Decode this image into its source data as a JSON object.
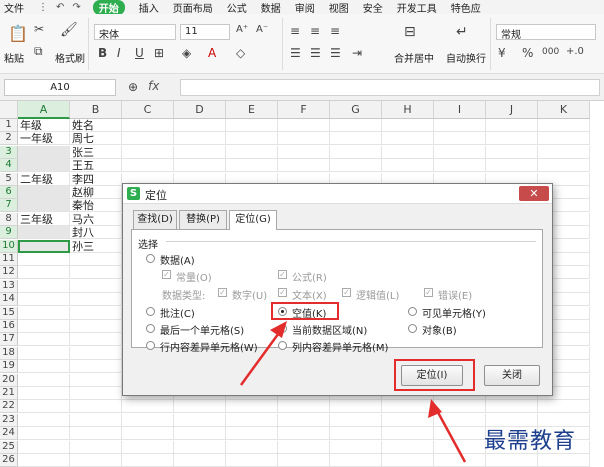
{
  "menubar": {
    "file": "文件",
    "quick": [
      "⋮",
      "↶",
      "↷"
    ],
    "items": [
      "开始",
      "插入",
      "页面布局",
      "公式",
      "数据",
      "审阅",
      "视图",
      "安全",
      "开发工具",
      "特色应"
    ],
    "active_index": 0
  },
  "ribbon": {
    "paste": "粘贴",
    "format_painter": "格式刷",
    "font_name": "宋体",
    "font_size": "11",
    "merge_center": "合并居中",
    "wrap_text": "自动换行",
    "number_format": "常规",
    "bold": "B",
    "italic": "I",
    "underline": "U",
    "percent": "%",
    "thousand": "000"
  },
  "formula_bar": {
    "name_box": "A10",
    "fx": "fx",
    "formula": ""
  },
  "columns": [
    "A",
    "B",
    "C",
    "D",
    "E",
    "F",
    "G",
    "H",
    "I",
    "J",
    "K"
  ],
  "rows": [
    "1",
    "2",
    "3",
    "4",
    "5",
    "6",
    "7",
    "8",
    "9",
    "10",
    "11",
    "12",
    "13",
    "14",
    "15",
    "16",
    "17",
    "18",
    "19",
    "20",
    "21",
    "22",
    "23",
    "24",
    "25",
    "26"
  ],
  "cells": {
    "A1": "年级",
    "B1": "姓名",
    "A2": "一年级",
    "B2": "周七",
    "A3": "",
    "B3": "张三",
    "A4": "",
    "B4": "王五",
    "A5": "二年级",
    "B5": "李四",
    "A6": "",
    "B6": "赵柳",
    "A7": "",
    "B7": "秦怡",
    "A8": "三年级",
    "B8": "马六",
    "A9": "",
    "B9": "封八",
    "A10": "",
    "B10": "孙三"
  },
  "dialog": {
    "title": "定位",
    "logo": "S",
    "close": "✕",
    "tabs": [
      "查找(D)",
      "替换(P)",
      "定位(G)"
    ],
    "group_label": "选择",
    "options": {
      "data": "数据(A)",
      "constant": "常量(O)",
      "formula": "公式(R)",
      "data_type": "数据类型:",
      "number": "数字(U)",
      "text": "文本(X)",
      "logical": "逻辑值(L)",
      "error": "错误(E)",
      "comment": "批注(C)",
      "blank": "空值(K)",
      "visible": "可见单元格(Y)",
      "last_cell": "最后一个单元格(S)",
      "current_region": "当前数据区域(N)",
      "object": "对象(B)",
      "row_diff": "行内容差异单元格(W)",
      "col_diff": "列内容差异单元格(M)"
    },
    "locate_button": "定位(I)",
    "close_button": "关闭"
  },
  "watermark": "最需教育",
  "colors": {
    "accent": "#2fae4f",
    "highlight": "#e32c2c"
  }
}
